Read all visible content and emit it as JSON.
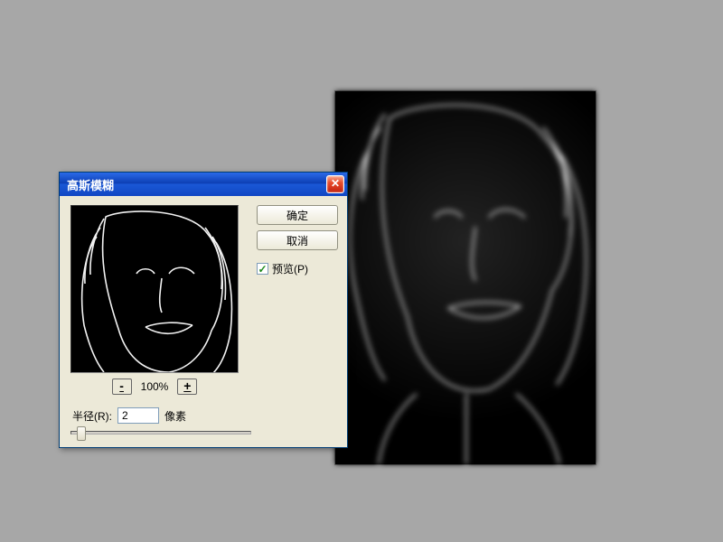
{
  "canvas": {
    "alt": "edge-detected-portrait-blurred"
  },
  "dialog": {
    "title": "高斯模糊",
    "close": "✕",
    "ok_label": "确定",
    "cancel_label": "取消",
    "preview_checkbox_label": "预览(P)",
    "preview_checked": true,
    "zoom": {
      "out": "-",
      "in": "+",
      "percent": "100%"
    },
    "radius": {
      "label": "半径(R):",
      "value": "2",
      "unit": "像素"
    }
  }
}
